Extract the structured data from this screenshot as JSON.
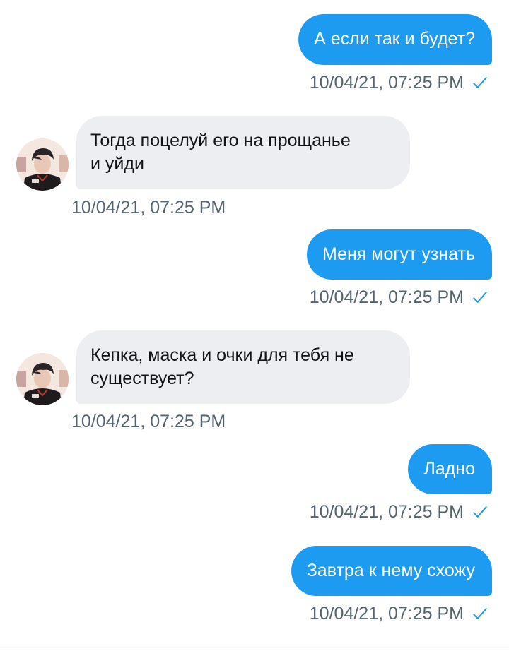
{
  "messages": [
    {
      "direction": "outgoing",
      "text": "А если так и будет?",
      "timestamp": "10/04/21, 07:25 PM",
      "status_icon": "sent-check-icon"
    },
    {
      "direction": "incoming",
      "text": "Тогда поцелуй его на прощанье\nи уйди",
      "timestamp": "10/04/21, 07:25 PM",
      "avatar_icon": "user-avatar"
    },
    {
      "direction": "outgoing",
      "text": "Меня могут узнать",
      "timestamp": "10/04/21, 07:25 PM",
      "status_icon": "sent-check-icon"
    },
    {
      "direction": "incoming",
      "text": "Кепка, маска и очки для тебя не\nсуществует?",
      "timestamp": "10/04/21, 07:25 PM",
      "avatar_icon": "user-avatar"
    },
    {
      "direction": "outgoing",
      "text": "Ладно",
      "timestamp": "10/04/21, 07:25 PM",
      "status_icon": "sent-check-icon"
    },
    {
      "direction": "outgoing",
      "text": "Завтра к нему схожу",
      "timestamp": "10/04/21, 07:25 PM",
      "status_icon": "sent-check-icon"
    }
  ],
  "colors": {
    "outgoing_bubble": "#1d9bf0",
    "incoming_bubble": "#eceef2",
    "timestamp_text": "#536471",
    "check_mark": "#1d9bf0"
  }
}
